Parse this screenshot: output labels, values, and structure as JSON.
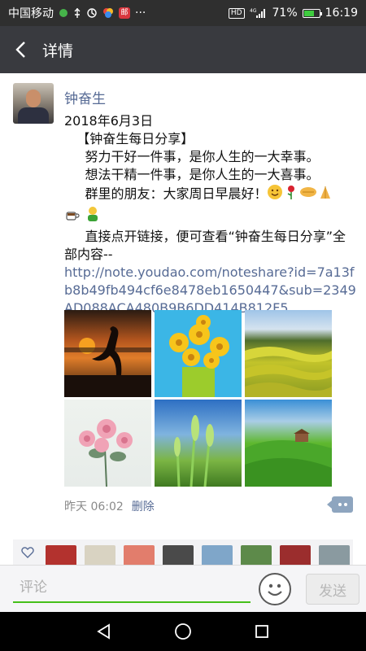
{
  "status_bar": {
    "carrier": "中国移动",
    "battery_level": 71,
    "battery_text": "71%",
    "network_label": "4G",
    "hd_label": "HD",
    "time": "16:19",
    "more_dots": "···",
    "badge_text": "邮"
  },
  "header": {
    "title": "详情",
    "back_icon": "back-arrow-icon"
  },
  "post": {
    "author": "钟奋生",
    "date_line": "2018年6月3日",
    "lines": [
      "   【钟奋生每日分享】",
      "     努力干好一件事，是你人生的一大幸事。",
      "     想法干精一件事，是你人生的一大喜事。",
      "     群里的朋友：大家周日早晨好！"
    ],
    "emoji_sequence": [
      "smile",
      "rose",
      "handshake",
      "pray",
      "coffee",
      "bless"
    ],
    "link_intro": "     直接点开链接，便可查看“钟奋生每日分享”全部内容--",
    "link": "http://note.youdao.com/noteshare?id=7a13fb8b49fb494cf6e8478eb1650447&sub=2349AD088ACA480B9B6DD414B812F5",
    "photos": [
      {
        "subject": "crane silhouette at sunset"
      },
      {
        "subject": "yellow daisies in pot"
      },
      {
        "subject": "terraced rapeseed fields"
      },
      {
        "subject": "pink roses"
      },
      {
        "subject": "green wheat ears"
      },
      {
        "subject": "green rolling hills"
      }
    ],
    "time": "昨天 06:02",
    "delete_label": "删除"
  },
  "likes": {
    "icon": "heart-outline-icon",
    "count_visible": 8
  },
  "comment_bar": {
    "placeholder": "评论",
    "send_label": "发送",
    "accent": "#45c01a"
  },
  "nav": {
    "icons": [
      "back-triangle-icon",
      "home-circle-icon",
      "recents-square-icon"
    ]
  },
  "colors": {
    "link": "#576b95",
    "title_bar": "#393a3f",
    "status_bar": "#2f2f2f"
  }
}
